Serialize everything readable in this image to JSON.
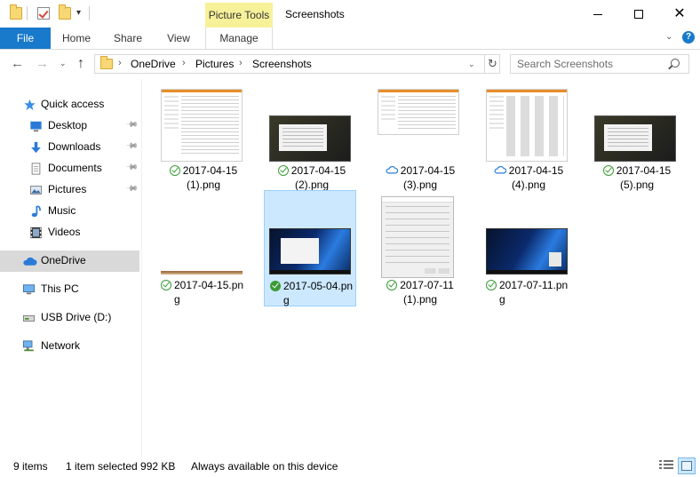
{
  "window": {
    "title": "Screenshots",
    "contextual_tab_label": "Picture Tools",
    "qat_dropdown_glyph": "▾",
    "minimize_label": "",
    "close_glyph": "✕"
  },
  "ribbon": {
    "tabs": [
      {
        "label": "File"
      },
      {
        "label": "Home"
      },
      {
        "label": "Share"
      },
      {
        "label": "View"
      },
      {
        "label": "Manage"
      }
    ],
    "expand_glyph": "⌄",
    "help_glyph": "?"
  },
  "nav": {
    "back_glyph": "←",
    "forward_glyph": "→",
    "recent_glyph": "⌄",
    "up_glyph": "↑",
    "breadcrumb": [
      "OneDrive",
      "Pictures",
      "Screenshots"
    ],
    "crumb_separator": "›",
    "address_dropdown_glyph": "⌄",
    "refresh_glyph": "↻",
    "search_placeholder": "Search Screenshots"
  },
  "sidebar": {
    "pin_glyph": "📌",
    "items": [
      {
        "label": "Quick access",
        "icon": "star-icon"
      },
      {
        "label": "Desktop",
        "icon": "desktop-icon",
        "pinned": true
      },
      {
        "label": "Downloads",
        "icon": "download-icon",
        "pinned": true
      },
      {
        "label": "Documents",
        "icon": "documents-icon",
        "pinned": true
      },
      {
        "label": "Pictures",
        "icon": "pictures-icon",
        "pinned": true
      },
      {
        "label": "Music",
        "icon": "music-icon"
      },
      {
        "label": "Videos",
        "icon": "videos-icon"
      },
      {
        "label": "OneDrive",
        "icon": "cloud-icon",
        "selected": true
      },
      {
        "label": "This PC",
        "icon": "computer-icon"
      },
      {
        "label": "USB Drive (D:)",
        "icon": "usb-drive-icon"
      },
      {
        "label": "Network",
        "icon": "network-icon"
      }
    ]
  },
  "files": [
    {
      "line1": "2017-04-15",
      "line2": "(1).png",
      "status": "synced",
      "thumb": "explorer-light"
    },
    {
      "line1": "2017-04-15",
      "line2": "(2).png",
      "status": "synced",
      "thumb": "explorer-dark"
    },
    {
      "line1": "2017-04-15",
      "line2": "(3).png",
      "status": "cloud",
      "thumb": "explorer-light"
    },
    {
      "line1": "2017-04-15",
      "line2": "(4).png",
      "status": "cloud",
      "thumb": "explorer-light"
    },
    {
      "line1": "2017-04-15",
      "line2": "(5).png",
      "status": "synced",
      "thumb": "explorer-dark"
    },
    {
      "line1": "2017-04-15.pn",
      "line2": "g",
      "status": "synced",
      "thumb": "strip"
    },
    {
      "line1": "2017-05-04.pn",
      "line2": "g",
      "status": "synced-filled",
      "thumb": "desktop",
      "selected": true
    },
    {
      "line1": "2017-07-11",
      "line2": "(1).png",
      "status": "synced",
      "thumb": "dialog"
    },
    {
      "line1": "2017-07-11.pn",
      "line2": "g",
      "status": "synced",
      "thumb": "desktop"
    }
  ],
  "status": {
    "item_count": "9 items",
    "selection": "1 item selected  992 KB",
    "availability": "Always available on this device"
  }
}
